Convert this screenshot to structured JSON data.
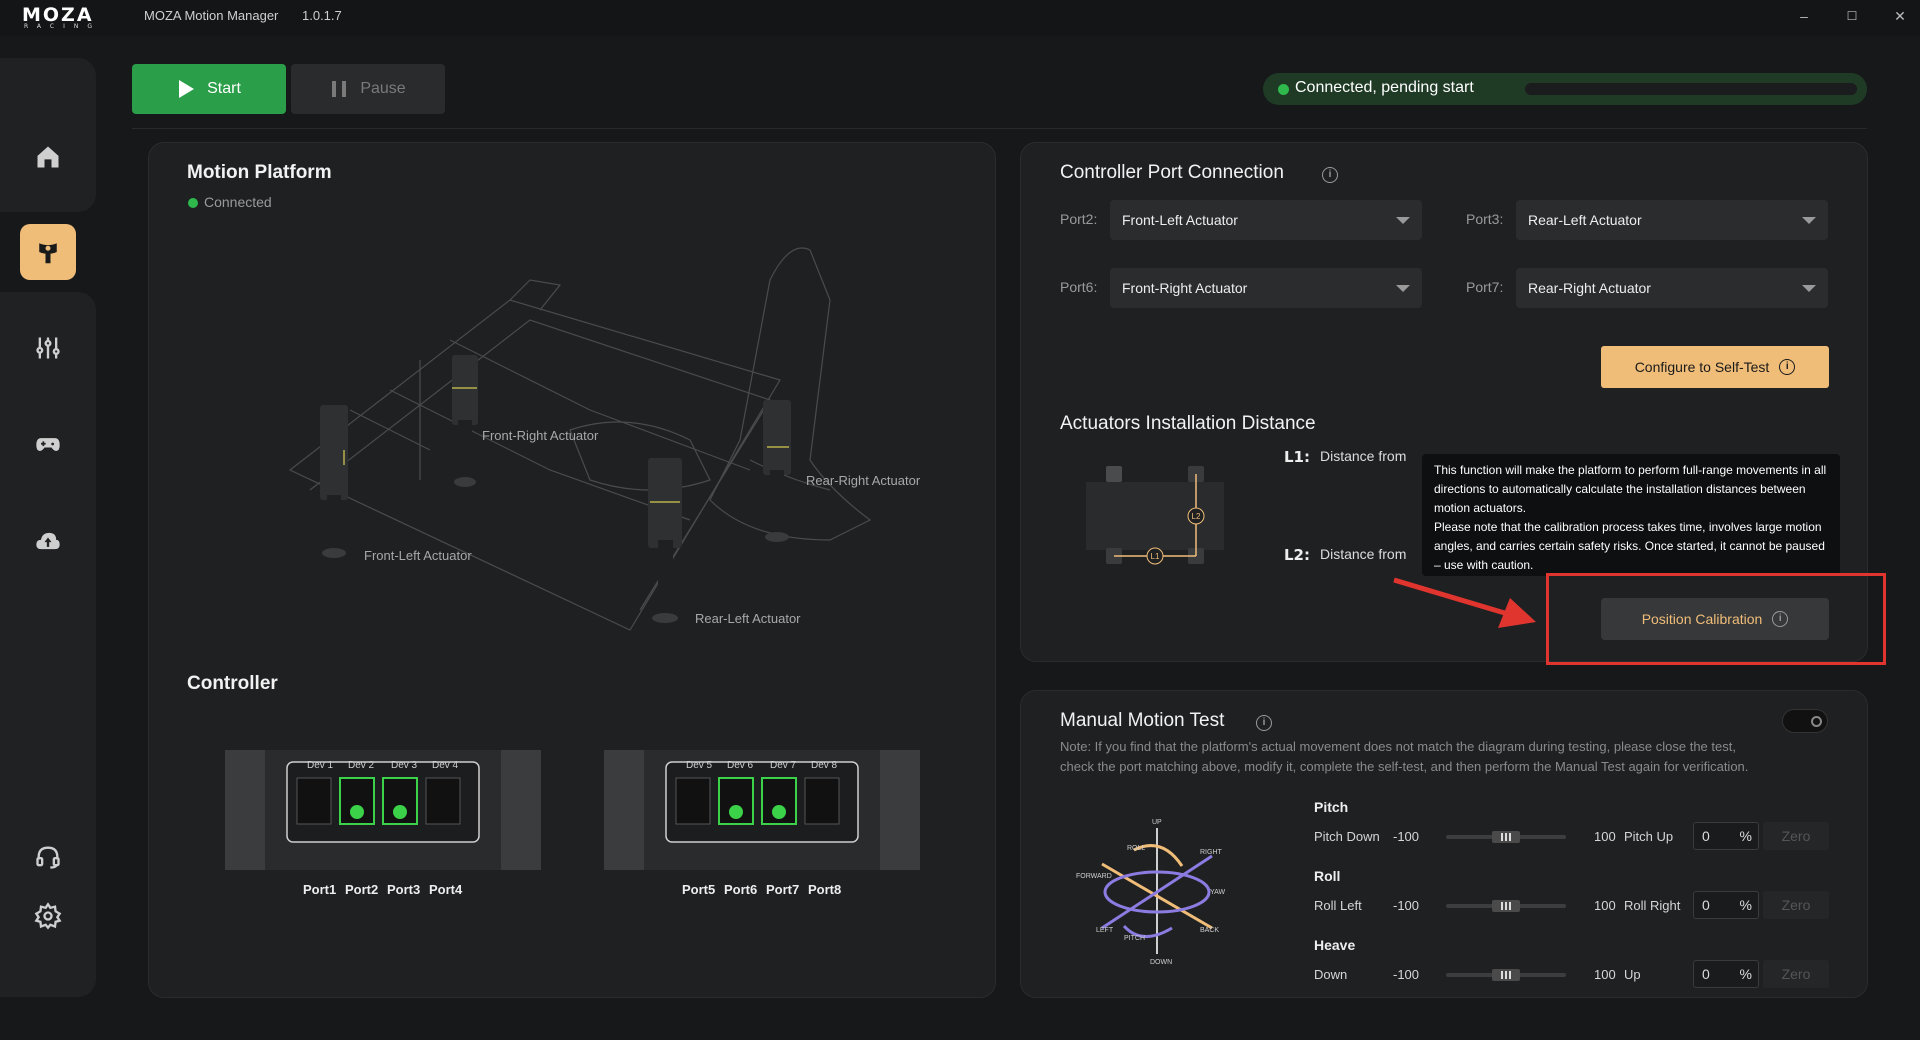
{
  "titlebar": {
    "logo_main": "MOZA",
    "logo_sub": "RACING",
    "app_name": "MOZA Motion Manager",
    "version": "1.0.1.7"
  },
  "window_controls": {
    "minimize": "–",
    "maximize": "☐",
    "close": "✕"
  },
  "toolbar": {
    "start_label": "Start",
    "pause_label": "Pause"
  },
  "status": {
    "text": "Connected, pending start",
    "color": "#2fb94d"
  },
  "motion_platform": {
    "title": "Motion Platform",
    "status": "Connected",
    "actuators": [
      "Front-Right Actuator",
      "Rear-Right Actuator",
      "Front-Left Actuator",
      "Rear-Left Actuator"
    ]
  },
  "controller": {
    "title": "Controller",
    "box1": {
      "devs": [
        "Dev 1",
        "Dev 2",
        "Dev 3",
        "Dev 4"
      ],
      "ports": [
        "Port1",
        "Port2",
        "Port3",
        "Port4"
      ]
    },
    "box2": {
      "devs": [
        "Dev 5",
        "Dev 6",
        "Dev 7",
        "Dev 8"
      ],
      "ports": [
        "Port5",
        "Port6",
        "Port7",
        "Port8"
      ]
    }
  },
  "port_connection": {
    "title": "Controller Port Connection",
    "rows": [
      {
        "port": "Port2:",
        "value": "Front-Left Actuator"
      },
      {
        "port": "Port3:",
        "value": "Rear-Left Actuator"
      },
      {
        "port": "Port6:",
        "value": "Front-Right Actuator"
      },
      {
        "port": "Port7:",
        "value": "Rear-Right Actuator"
      }
    ],
    "config_button": "Configure to Self-Test"
  },
  "install_distance": {
    "title": "Actuators Installation Distance",
    "l1_tag": "L1:",
    "l1_text": "Distance from",
    "l2_tag": "L2:",
    "l2_text": "Distance from",
    "diagram_l1": "L1",
    "diagram_l2": "L2",
    "tooltip_p1": "This function will make the platform to perform full-range movements in all directions to automatically calculate the installation distances between motion actuators.",
    "tooltip_p2": "Please note that the calibration process takes time, involves large motion angles, and carries certain safety risks. Once started, it cannot be paused – use with caution.",
    "calibration_button": "Position Calibration"
  },
  "manual_test": {
    "title": "Manual Motion Test",
    "note": "Note: If you find that the platform's actual movement does not match the diagram during testing, please close the test, check the port matching above, modify it, complete the self-test, and then perform the Manual Test again for verification.",
    "toggle_on": false,
    "diagram_labels": {
      "up": "UP",
      "down": "DOWN",
      "roll": "ROLL",
      "right": "RIGHT",
      "forward": "FORWARD",
      "yaw": "YAW",
      "left": "LEFT",
      "pitch": "PITCH",
      "back": "BACK"
    },
    "axes": [
      {
        "name": "Pitch",
        "neg_label": "Pitch Down",
        "min": "-100",
        "max": "100",
        "pos_label": "Pitch Up",
        "value": "0",
        "unit": "%",
        "zero_label": "Zero",
        "slider_fraction": 0.5
      },
      {
        "name": "Roll",
        "neg_label": "Roll Left",
        "min": "-100",
        "max": "100",
        "pos_label": "Roll Right",
        "value": "0",
        "unit": "%",
        "zero_label": "Zero",
        "slider_fraction": 0.5
      },
      {
        "name": "Heave",
        "neg_label": "Down",
        "min": "-100",
        "max": "100",
        "pos_label": "Up",
        "value": "0",
        "unit": "%",
        "zero_label": "Zero",
        "slider_fraction": 0.5
      }
    ]
  },
  "icons": [
    "home-icon",
    "motion-platform-icon",
    "equalizer-icon",
    "gamepad-icon",
    "cloud-upload-icon",
    "headset-icon",
    "settings-icon",
    "info-icon",
    "caret-down-icon"
  ],
  "colors": {
    "accent": "#f0bd79",
    "start_green": "#2a9e48",
    "highlight_red": "#e0352f"
  }
}
